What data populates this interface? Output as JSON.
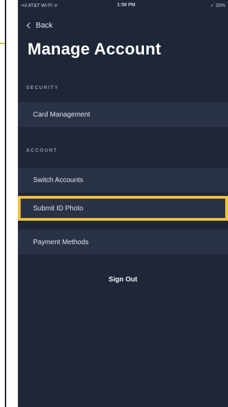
{
  "status_bar": {
    "carrier": "•ııl AT&T Wi-Fi ᯤ",
    "time": "1:58 PM",
    "battery": "✓ 33%"
  },
  "nav": {
    "back_label": "Back"
  },
  "page": {
    "title": "Manage Account"
  },
  "sections": {
    "security_label": "SECURITY",
    "account_label": "ACCOUNT"
  },
  "items": {
    "card_management": "Card Management",
    "switch_accounts": "Switch Accounts",
    "submit_id_photo": "Submit ID Photo",
    "payment_methods": "Payment Methods"
  },
  "actions": {
    "sign_out": "Sign Out"
  },
  "colors": {
    "highlight": "#f2c23e",
    "background": "#1e2637",
    "row": "#2a3346"
  }
}
